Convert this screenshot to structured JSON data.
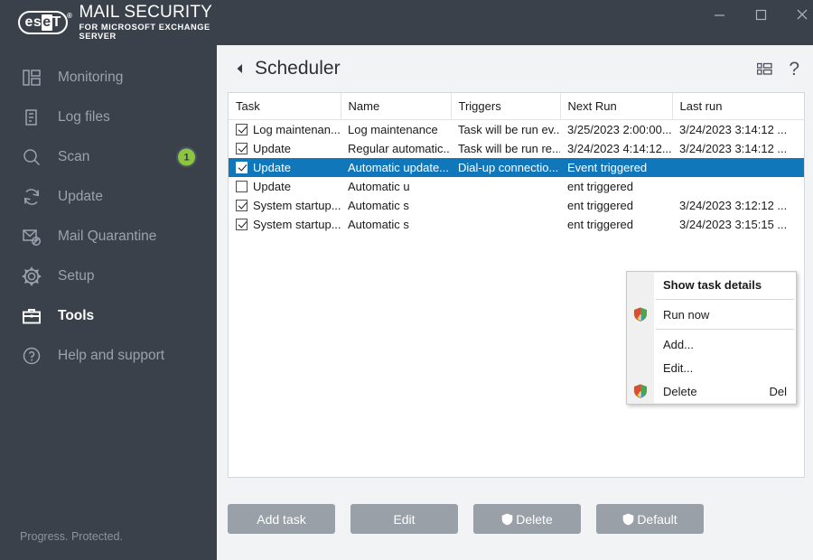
{
  "window": {
    "brand_logo_left": "es",
    "brand_logo_mid": "e",
    "brand_logo_right": "T",
    "brand_reg": "®",
    "brand_title": "MAIL SECURITY",
    "brand_subtitle": "FOR MICROSOFT EXCHANGE SERVER",
    "minimize_label": "Minimize",
    "maximize_label": "Maximize",
    "close_label": "Close"
  },
  "sidebar": {
    "items": [
      {
        "label": "Monitoring",
        "icon": "monitoring-icon",
        "active": false,
        "badge": null
      },
      {
        "label": "Log files",
        "icon": "log-files-icon",
        "active": false,
        "badge": null
      },
      {
        "label": "Scan",
        "icon": "scan-icon",
        "active": false,
        "badge": "1"
      },
      {
        "label": "Update",
        "icon": "update-icon",
        "active": false,
        "badge": null
      },
      {
        "label": "Mail Quarantine",
        "icon": "mail-quarantine-icon",
        "active": false,
        "badge": null
      },
      {
        "label": "Setup",
        "icon": "setup-gear-icon",
        "active": false,
        "badge": null
      },
      {
        "label": "Tools",
        "icon": "tools-briefcase-icon",
        "active": true,
        "badge": null
      },
      {
        "label": "Help and support",
        "icon": "help-circle-icon",
        "active": false,
        "badge": null
      }
    ],
    "status": "Progress. Protected."
  },
  "page": {
    "title": "Scheduler",
    "back_label": "Back",
    "list_view_label": "List view",
    "help_label": "Help"
  },
  "table": {
    "columns": [
      "Task",
      "Name",
      "Triggers",
      "Next Run",
      "Last run"
    ],
    "rows": [
      {
        "checked": true,
        "selected": false,
        "task": "Log maintenan...",
        "name": "Log maintenance",
        "triggers": "Task will be run ev...",
        "next_run": "3/25/2023 2:00:00...",
        "last_run": "3/24/2023 3:14:12 ..."
      },
      {
        "checked": true,
        "selected": false,
        "task": "Update",
        "name": "Regular automatic...",
        "triggers": "Task will be run re...",
        "next_run": "3/24/2023 4:14:12...",
        "last_run": "3/24/2023 3:14:12 ..."
      },
      {
        "checked": true,
        "selected": true,
        "task": "Update",
        "name": "Automatic update...",
        "triggers": "Dial-up connectio...",
        "next_run": "Event triggered",
        "last_run": ""
      },
      {
        "checked": false,
        "selected": false,
        "task": "Update",
        "name": "Automatic u",
        "triggers": "",
        "next_run": "ent triggered",
        "last_run": ""
      },
      {
        "checked": true,
        "selected": false,
        "task": "System startup...",
        "name": "Automatic s",
        "triggers": "",
        "next_run": "ent triggered",
        "last_run": "3/24/2023 3:12:12 ..."
      },
      {
        "checked": true,
        "selected": false,
        "task": "System startup...",
        "name": "Automatic s",
        "triggers": "",
        "next_run": "ent triggered",
        "last_run": "3/24/2023 3:15:15 ..."
      }
    ]
  },
  "context_menu": {
    "items": [
      {
        "label": "Show task details",
        "bold": true,
        "shield": false,
        "shortcut": "",
        "separator_after": true
      },
      {
        "label": "Run now",
        "bold": false,
        "shield": true,
        "shortcut": "",
        "separator_after": true
      },
      {
        "label": "Add...",
        "bold": false,
        "shield": false,
        "shortcut": "",
        "separator_after": false
      },
      {
        "label": "Edit...",
        "bold": false,
        "shield": false,
        "shortcut": "",
        "separator_after": false
      },
      {
        "label": "Delete",
        "bold": false,
        "shield": true,
        "shortcut": "Del",
        "separator_after": false
      }
    ]
  },
  "footer": {
    "buttons": [
      {
        "label": "Add task",
        "shield": false
      },
      {
        "label": "Edit",
        "shield": false
      },
      {
        "label": "Delete",
        "shield": true
      },
      {
        "label": "Default",
        "shield": true
      }
    ]
  },
  "colors": {
    "sidebar_bg": "#3a414b",
    "main_bg": "#f2f3f5",
    "selection_blue": "#1177bb",
    "badge_green": "#8cc63f",
    "button_gray": "#9aa0a8"
  }
}
